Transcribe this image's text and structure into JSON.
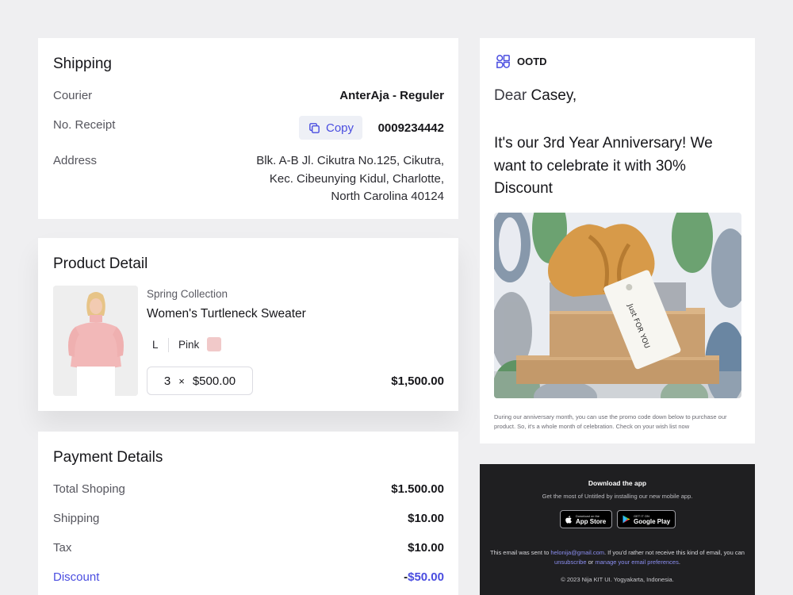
{
  "shipping": {
    "title": "Shipping",
    "courier_label": "Courier",
    "courier_value": "AnterAja - Reguler",
    "receipt_label": "No. Receipt",
    "copy_label": "Copy",
    "receipt_value": "0009234442",
    "address_label": "Address",
    "address_lines": [
      "Blk. A-B Jl. Cikutra No.125, Cikutra,",
      "Kec. Cibeunying Kidul, Charlotte,",
      "North Carolina 40124"
    ]
  },
  "product": {
    "title": "Product Detail",
    "collection": "Spring Collection",
    "name": "Women's Turtleneck Sweater",
    "size": "L",
    "color_name": "Pink",
    "color_hex": "#f1c9c9",
    "quantity": "3",
    "times": "×",
    "unit_price": "$500.00",
    "total": "$1,500.00"
  },
  "payment": {
    "title": "Payment Details",
    "rows": [
      {
        "label": "Total Shoping",
        "value": "$1.500.00"
      },
      {
        "label": "Shipping",
        "value": "$10.00"
      },
      {
        "label": "Tax",
        "value": "$10.00"
      },
      {
        "label": "Discount",
        "value_sign": "-",
        "value": "$50.00"
      }
    ]
  },
  "email": {
    "brand": "OOTD",
    "greeting": "Dear",
    "name": "Casey,",
    "headline": "It's our 3rd Year Anniversary! We want to celebrate it with 30% Discount",
    "tag_text": "Just FOR YOU",
    "body": "During our anniversary month, you can use the promo code down below to purchase our product. So, it's a whole month of celebration. Check on your wish list now"
  },
  "footer": {
    "download_title": "Download the app",
    "download_sub": "Get the most of Untitled by installing our new mobile app.",
    "appstore_small": "Download on the",
    "appstore_big": "App Store",
    "play_small": "GET IT ON",
    "play_big": "Google Play",
    "legal_prefix": "This email was sent to",
    "legal_email": "helonija@gmail.com",
    "legal_mid": ". If you'd rather not receive this kind of email, you can",
    "legal_unsub": "unsubscribe",
    "legal_or": "or",
    "legal_prefs": "manage your email preferences",
    "legal_end": ".",
    "copyright": "© 2023 Nija KIT UI. Yogyakarta, Indonesia."
  },
  "colors": {
    "accent": "#4a4de0",
    "dark_footer": "#1f1f21",
    "background": "#efeff1"
  }
}
